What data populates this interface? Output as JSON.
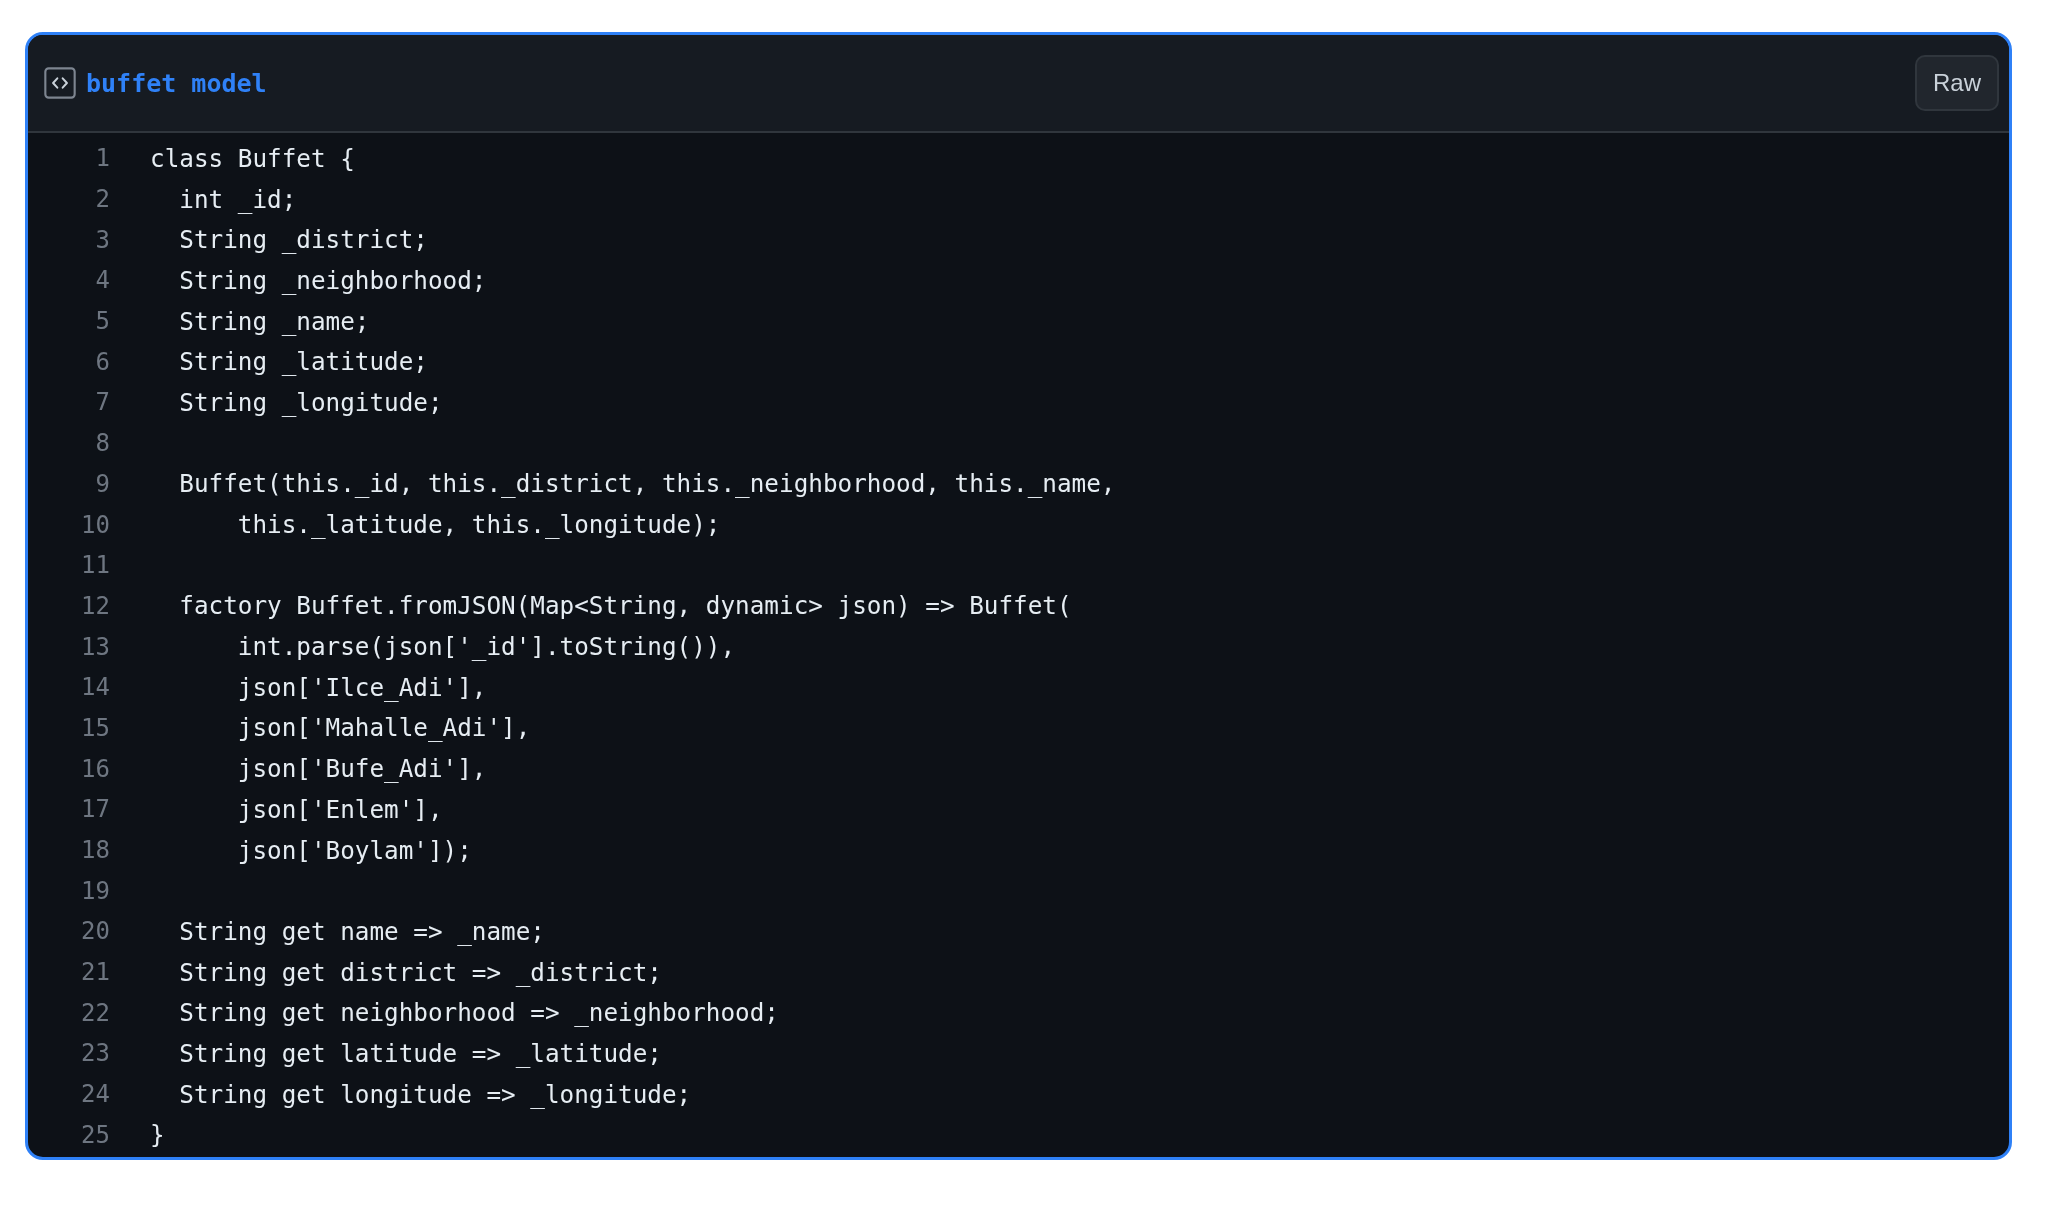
{
  "file": {
    "title": "buffet model",
    "raw_button": "Raw"
  },
  "lines": [
    {
      "number": "1",
      "code": "class Buffet {"
    },
    {
      "number": "2",
      "code": "  int _id;"
    },
    {
      "number": "3",
      "code": "  String _district;"
    },
    {
      "number": "4",
      "code": "  String _neighborhood;"
    },
    {
      "number": "5",
      "code": "  String _name;"
    },
    {
      "number": "6",
      "code": "  String _latitude;"
    },
    {
      "number": "7",
      "code": "  String _longitude;"
    },
    {
      "number": "8"
    },
    {
      "number": "9",
      "code": "  Buffet(this._id, this._district, this._neighborhood, this._name,"
    },
    {
      "number": "10",
      "code": "      this._latitude, this._longitude);"
    },
    {
      "number": "11"
    },
    {
      "number": "12",
      "code": "  factory Buffet.fromJSON(Map<String, dynamic> json) => Buffet("
    },
    {
      "number": "13",
      "code": "      int.parse(json['_id'].toString()),"
    },
    {
      "number": "14",
      "code": "      json['Ilce_Adi'],"
    },
    {
      "number": "15",
      "code": "      json['Mahalle_Adi'],"
    },
    {
      "number": "16",
      "code": "      json['Bufe_Adi'],"
    },
    {
      "number": "17",
      "code": "      json['Enlem'],"
    },
    {
      "number": "18",
      "code": "      json['Boylam']);"
    },
    {
      "number": "19"
    },
    {
      "number": "20",
      "code": "  String get name => _name;"
    },
    {
      "number": "21",
      "code": "  String get district => _district;"
    },
    {
      "number": "22",
      "code": "  String get neighborhood => _neighborhood;"
    },
    {
      "number": "23",
      "code": "  String get latitude => _latitude;"
    },
    {
      "number": "24",
      "code": "  String get longitude => _longitude;"
    },
    {
      "number": "25",
      "code": "}"
    }
  ]
}
